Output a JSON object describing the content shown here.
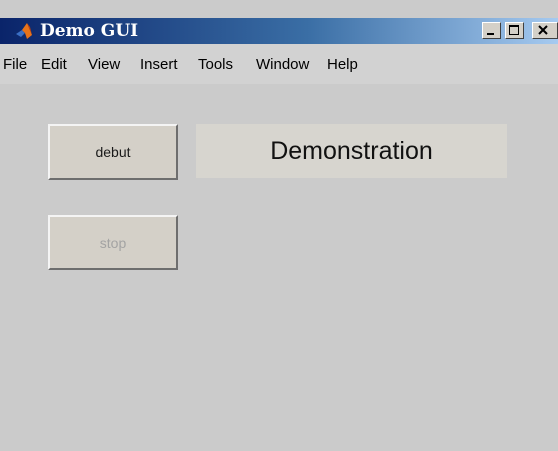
{
  "window": {
    "title": "Demo GUI",
    "app_icon": "matlab-logo-icon",
    "controls": {
      "minimize_icon": "minimize-icon",
      "maximize_icon": "maximize-icon",
      "close_icon": "close-icon"
    }
  },
  "menu": {
    "items": [
      "File",
      "Edit",
      "View",
      "Insert",
      "Tools",
      "Window",
      "Help"
    ]
  },
  "content": {
    "debut_button": "debut",
    "stop_button": "stop",
    "stop_enabled": false,
    "display_text": "Demonstration"
  },
  "colors": {
    "titlebar_start": "#0a246a",
    "titlebar_end": "#a6caf0",
    "window_background": "#cbcbcb",
    "button_face": "#d4d0c8",
    "disabled_text": "#a3a3a3"
  }
}
